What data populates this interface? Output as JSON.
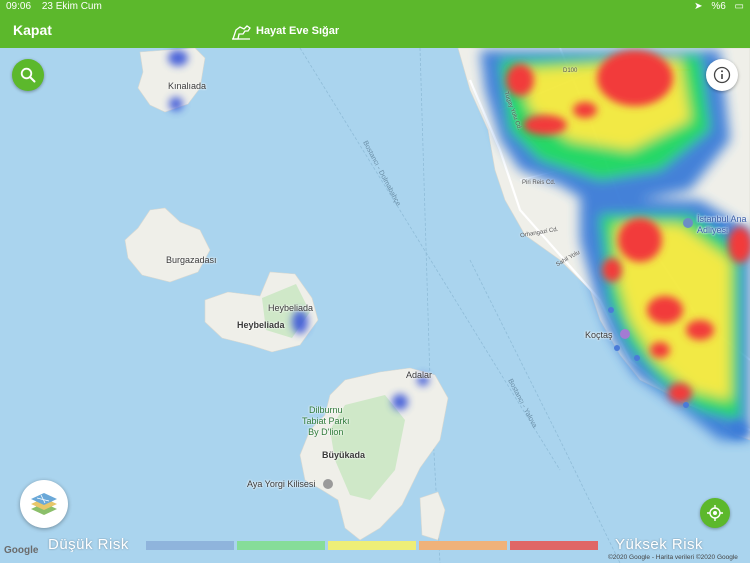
{
  "status_bar": {
    "time": "09:06",
    "date": "23 Ekim Cum",
    "battery": "%6"
  },
  "header": {
    "close_label": "Kapat",
    "app_title": "Hayat Eve Sığar"
  },
  "map": {
    "places": {
      "kinaliada": "Kınalıada",
      "burgazadasi": "Burgazadası",
      "heybeliada_top": "Heybeliada",
      "heybeliada": "Heybeliada",
      "adalar": "Adalar",
      "dilburnu": "Dilburnu\nTabiat Parkı\nBy D'lion",
      "buyukada": "Büyükada",
      "aya_yorgi": "Aya Yorgi Kilisesi",
      "kocatas": "Koçtaş",
      "istanbul_adliyesi": "İstanbul Ana\nAdliyesi"
    },
    "roads": {
      "d100": "D100",
      "pirireis": "Piri Reis Cd.",
      "tugay": "Tugay Yolu Cd.",
      "orhangazi": "Orhangazi Cd.",
      "sahil": "Sahil Yolu"
    },
    "sea_routes": {
      "route1": "Bostancı - Dolmabahçe",
      "route2": "Bostancı - Yalova"
    }
  },
  "buttons": {
    "search_icon": "search-icon",
    "info_icon": "info-icon",
    "layers_icon": "map-layers-icon",
    "locate_icon": "locate-icon"
  },
  "legend": {
    "low_label": "Düşük Risk",
    "high_label": "Yüksek Risk",
    "colors": [
      "#8fb4dc",
      "#86dd99",
      "#eeee77",
      "#f0b27a",
      "#e06666"
    ]
  },
  "map_attribution": {
    "google_logo": "Google",
    "text": "©2020 Google - Harita verileri ©2020 Google"
  },
  "heatmap_colors": {
    "low": "#3b7bd8",
    "mid": "#1ed760",
    "high_mid": "#f3e93c",
    "high": "#f23b3b"
  }
}
